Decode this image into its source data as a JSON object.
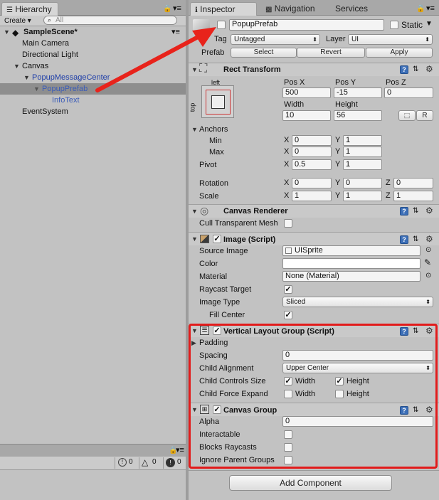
{
  "hierarchy": {
    "tab": "Hierarchy",
    "create": "Create ▾",
    "search_placeholder": "All",
    "scene": "SampleScene*",
    "items": [
      "Main Camera",
      "Directional Light",
      "Canvas",
      "PopupMessageCenter",
      "PopupPrefab",
      "InfoText",
      "EventSystem"
    ]
  },
  "console": {
    "c1": "0",
    "c2": "0",
    "c3": "0"
  },
  "tabs": {
    "inspector": "Inspector",
    "navigation": "Navigation",
    "services": "Services"
  },
  "go": {
    "name": "PopupPrefab",
    "static": "Static",
    "tag_label": "Tag",
    "tag": "Untagged",
    "layer_label": "Layer",
    "layer": "UI",
    "prefab_label": "Prefab",
    "select": "Select",
    "revert": "Revert",
    "apply": "Apply"
  },
  "rect": {
    "title": "Rect Transform",
    "left": "left",
    "top": "top",
    "posx_l": "Pos X",
    "posy_l": "Pos Y",
    "posz_l": "Pos Z",
    "posx": "500",
    "posy": "-15",
    "posz": "0",
    "width_l": "Width",
    "height_l": "Height",
    "width": "10",
    "height": "56",
    "r": "R",
    "anchors": "Anchors",
    "min": "Min",
    "max": "Max",
    "pivot": "Pivot",
    "rotation": "Rotation",
    "scale": "Scale",
    "X": "X",
    "Y": "Y",
    "Z": "Z",
    "min_x": "0",
    "min_y": "1",
    "max_x": "0",
    "max_y": "1",
    "pivot_x": "0.5",
    "pivot_y": "1",
    "rot_x": "0",
    "rot_y": "0",
    "rot_z": "0",
    "sc_x": "1",
    "sc_y": "1",
    "sc_z": "1"
  },
  "canvas_renderer": {
    "title": "Canvas Renderer",
    "cull": "Cull Transparent Mesh"
  },
  "image": {
    "title": "Image (Script)",
    "source_l": "Source Image",
    "source": "UISprite",
    "color_l": "Color",
    "material_l": "Material",
    "material": "None (Material)",
    "raycast_l": "Raycast Target",
    "type_l": "Image Type",
    "type": "Sliced",
    "fill_l": "Fill Center"
  },
  "vlg": {
    "title": "Vertical Layout Group (Script)",
    "padding": "Padding",
    "spacing_l": "Spacing",
    "spacing": "0",
    "align_l": "Child Alignment",
    "align": "Upper Center",
    "controls_l": "Child Controls Size",
    "expand_l": "Child Force Expand",
    "w": "Width",
    "h": "Height"
  },
  "cg": {
    "title": "Canvas Group",
    "alpha_l": "Alpha",
    "alpha": "0",
    "interact_l": "Interactable",
    "block_l": "Blocks Raycasts",
    "ignore_l": "Ignore Parent Groups"
  },
  "add_component": "Add Component",
  "colors": {
    "highlight": "#e21b1b",
    "selection": "#8e8e8e",
    "link": "#1e3ea8"
  }
}
